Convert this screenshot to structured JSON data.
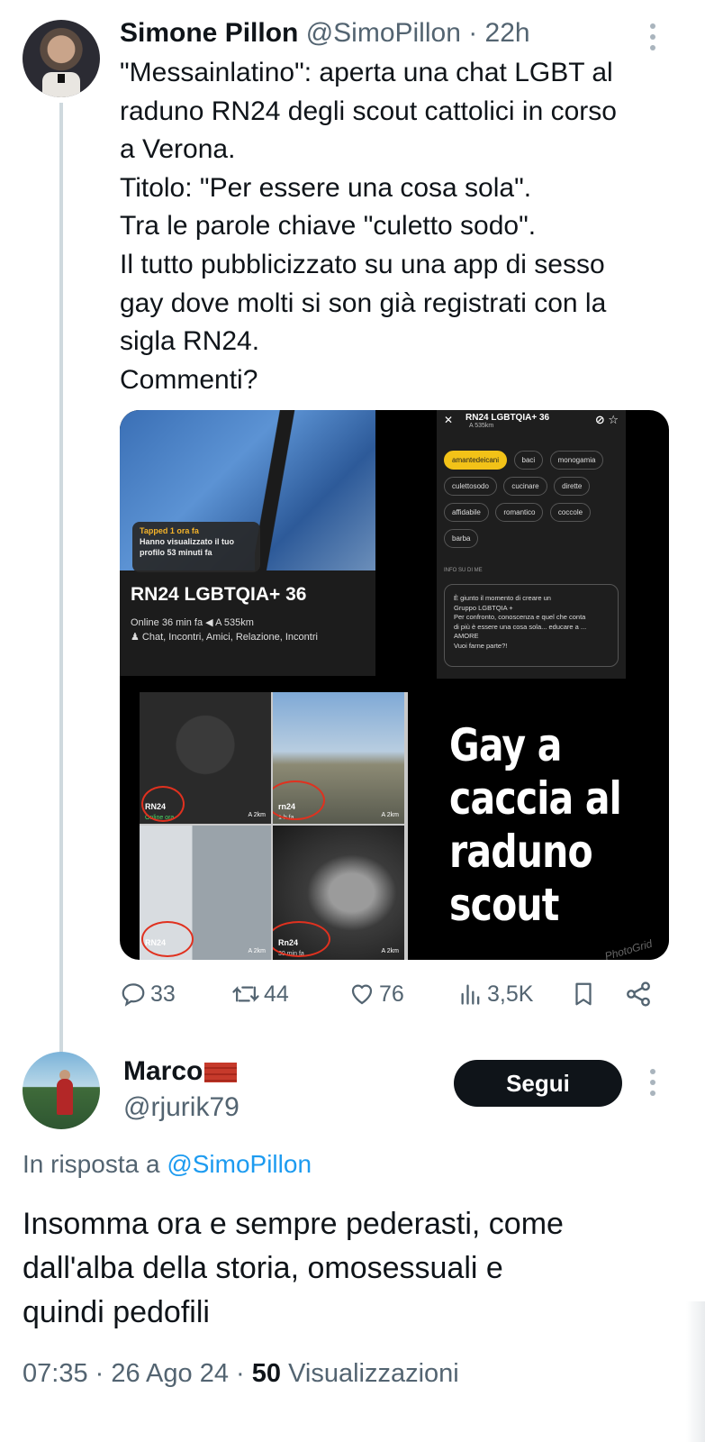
{
  "tweet1": {
    "author_name": "Simone Pillon",
    "handle": "@SimoPillon",
    "time": "· 22h",
    "text_lines": [
      "\"Messainlatino\": aperta una chat LGBT al",
      "raduno RN24 degli scout cattolici in corso",
      "a Verona.",
      "Titolo: \"Per essere una cosa sola\".",
      "Tra le parole chiave \"culetto sodo\".",
      "Il tutto pubblicizzato su una app di sesso",
      "gay dove molti si son già registrati con la",
      "sigla RN24.",
      "Commenti?"
    ],
    "media": {
      "profile": {
        "tapped": "Tapped 1 ora fa",
        "seen": "Hanno visualizzato il tuo profilo 53 minuti fa",
        "title": "RN24 LGBTQIA+ 36",
        "online": "Online 36 min fa  ◀ A 535km",
        "interests": "♟ Chat, Incontri, Amici, Relazione, Incontri"
      },
      "detail": {
        "title": "RN24 LGBTQIA+ 36",
        "subtitle": "A 535km",
        "tags": [
          "amantedeicani",
          "baci",
          "monogamia",
          "culettosodo",
          "cucinare",
          "dirette",
          "affidabile",
          "romantico",
          "coccole",
          "barba"
        ],
        "info_label": "INFO SU DI ME",
        "info_text": [
          "È giunto il momento di creare un",
          "Gruppo LGBTQIA +",
          "Per confronto, conoscenza e quel che conta",
          "di più è essere una cosa sola... educare a ...",
          "AMORE",
          "Vuoi farne parte?!"
        ]
      },
      "grid": [
        {
          "label": "RN24",
          "status": "Online ora",
          "distance": "A 2km"
        },
        {
          "label": "rn24",
          "status": "1 h fa",
          "distance": "A 2km"
        },
        {
          "label": "RN24",
          "status": "1 h fa...",
          "distance": "A 2km"
        },
        {
          "label": "Rn24",
          "status": "30 min fa",
          "distance": "A 2km"
        }
      ],
      "headline": [
        "Gay a",
        "caccia al",
        "raduno",
        "scout"
      ],
      "watermark": "PhotoGrid"
    },
    "stats": {
      "replies": "33",
      "retweets": "44",
      "likes": "76",
      "views": "3,5K"
    }
  },
  "tweet2": {
    "author_name": "Marco",
    "handle": "@rjurik79",
    "follow_label": "Segui",
    "reply_prefix": "In risposta a",
    "reply_mention": "@SimoPillon",
    "text_lines": [
      "Insomma ora  e sempre pederasti, come",
      "dall'alba della storia, omosessuali e",
      "quindi pedofili"
    ],
    "time": "07:35 · 26 Ago 24 ·",
    "views_count": "50",
    "views_label": "Visualizzazioni"
  },
  "colors": {
    "text": "#0f1419",
    "secondary": "#536471",
    "link": "#1d9bf0",
    "thread_line": "#cfd9de"
  }
}
